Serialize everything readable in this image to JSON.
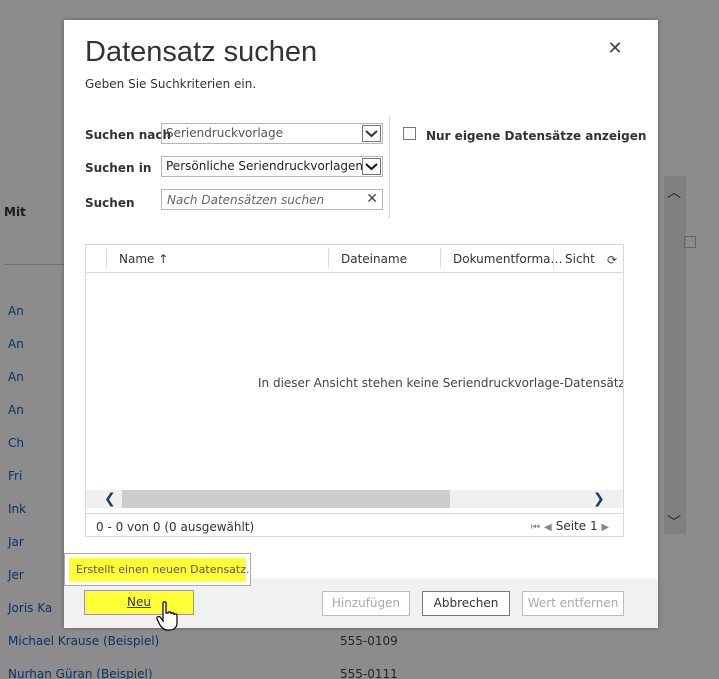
{
  "background": {
    "section_label": "Mit",
    "rows": [
      {
        "name": "An",
        "phone": ""
      },
      {
        "name": "An",
        "phone": ""
      },
      {
        "name": "An",
        "phone": ""
      },
      {
        "name": "An",
        "phone": ""
      },
      {
        "name": "Ch",
        "phone": ""
      },
      {
        "name": "Fri",
        "phone": ""
      },
      {
        "name": "Ink",
        "phone": ""
      },
      {
        "name": "Jar",
        "phone": ""
      },
      {
        "name": "Jer",
        "phone": ""
      },
      {
        "name": "Joris Ka",
        "phone": ""
      },
      {
        "name": "Michael Krause (Beispiel)",
        "phone": "555-0109"
      },
      {
        "name": "Nurhan Güran (Beispiel)",
        "phone": "555-0111"
      }
    ]
  },
  "dialog": {
    "title": "Datensatz suchen",
    "subtitle": "Geben Sie Suchkriterien ein.",
    "close_glyph": "✕",
    "search_for_label": "Suchen nach",
    "search_for_value": "Seriendruckvorlage",
    "search_in_label": "Suchen in",
    "search_in_value": "Persönliche Seriendruckvorlagen",
    "search_label": "Suchen",
    "search_placeholder": "Nach Datensätzen suchen",
    "own_records_label": "Nur eigene Datensätze anzeigen",
    "grid": {
      "columns": [
        "Name ↑",
        "Dateiname",
        "Dokumentforma…",
        "Sicht"
      ],
      "empty_message": "In dieser Ansicht stehen keine Seriendruckvorlage-Datensätze zur Verfügung.",
      "count": "0 - 0  von 0 (0 ausgewählt)",
      "page": "Seite 1"
    },
    "tooltip": "Erstellt einen neuen Datensatz.",
    "buttons": {
      "new": "Neu",
      "add": "Hinzufügen",
      "cancel": "Abbrechen",
      "remove": "Wert entfernen"
    }
  },
  "colors": {
    "highlight": "#ffff33",
    "link": "#1160b7"
  }
}
